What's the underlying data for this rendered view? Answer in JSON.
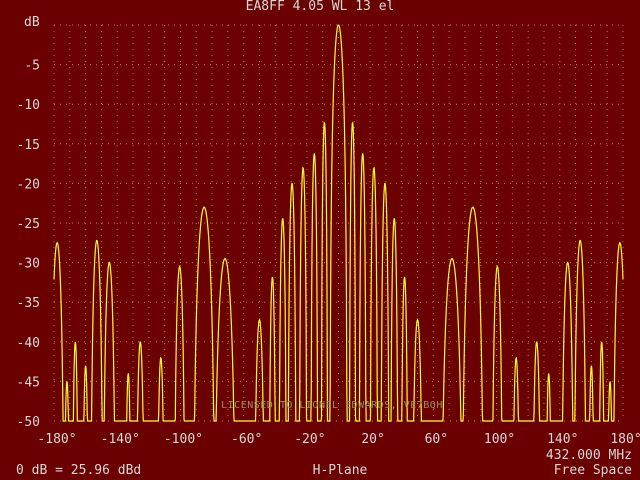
{
  "window": {
    "title": "EA8FF  4.05 WL 13 el",
    "y_unit": "dB",
    "footer_left": "0 dB = 25.96 dBd",
    "footer_center": "H-Plane",
    "frequency": "432.000 MHz",
    "footer_right": "Free Space",
    "watermark": "LICENSED TO LIONEL EDWARDS, VE7BQH"
  },
  "colors": {
    "background": "#6b0000",
    "trace": "#ffff30",
    "grid": "#c07070",
    "text": "#d8d8d8"
  },
  "chart_data": {
    "type": "line",
    "xlim": [
      -180,
      180
    ],
    "ylim": [
      -50,
      0
    ],
    "x_ticks": [
      {
        "v": -180,
        "label": "-180°"
      },
      {
        "v": -140,
        "label": "-140°"
      },
      {
        "v": -100,
        "label": "-100°"
      },
      {
        "v": -60,
        "label": "-60°"
      },
      {
        "v": -20,
        "label": "-20°"
      },
      {
        "v": 20,
        "label": "20°"
      },
      {
        "v": 60,
        "label": "60°"
      },
      {
        "v": 100,
        "label": "100°"
      },
      {
        "v": 140,
        "label": "140°"
      },
      {
        "v": 180,
        "label": "180°"
      }
    ],
    "y_ticks": [
      {
        "v": -5,
        "label": "-5"
      },
      {
        "v": -10,
        "label": "-10"
      },
      {
        "v": -15,
        "label": "-15"
      },
      {
        "v": -20,
        "label": "-20"
      },
      {
        "v": -25,
        "label": "-25"
      },
      {
        "v": -30,
        "label": "-30"
      },
      {
        "v": -35,
        "label": "-35"
      },
      {
        "v": -40,
        "label": "-40"
      },
      {
        "v": -45,
        "label": "-45"
      },
      {
        "v": -50,
        "label": "-50"
      }
    ],
    "grid": true,
    "pattern_lobes": [
      {
        "center": 0,
        "peak": 0,
        "halfwidth": 5.5
      },
      {
        "center": 8.9,
        "peak": -12.3,
        "halfwidth": 2.0
      },
      {
        "center": -8.9,
        "peak": -12.3,
        "halfwidth": 2.0
      },
      {
        "center": 15.3,
        "peak": -16.2,
        "halfwidth": 2.2
      },
      {
        "center": -15.3,
        "peak": -16.2,
        "halfwidth": 2.2
      },
      {
        "center": 22.4,
        "peak": -18.0,
        "halfwidth": 2.4
      },
      {
        "center": -22.4,
        "peak": -18.0,
        "halfwidth": 2.4
      },
      {
        "center": 29.4,
        "peak": -20.0,
        "halfwidth": 2.6
      },
      {
        "center": -29.4,
        "peak": -20.0,
        "halfwidth": 2.6
      },
      {
        "center": 35.3,
        "peak": -24.4,
        "halfwidth": 2.4
      },
      {
        "center": -35.3,
        "peak": -24.4,
        "halfwidth": 2.4
      },
      {
        "center": 41.8,
        "peak": -31.8,
        "halfwidth": 2.2
      },
      {
        "center": -41.8,
        "peak": -31.8,
        "halfwidth": 2.2
      },
      {
        "center": 50.0,
        "peak": -37.2,
        "halfwidth": 3.5
      },
      {
        "center": -50.0,
        "peak": -37.2,
        "halfwidth": 3.5
      },
      {
        "center": 71.8,
        "peak": -29.5,
        "halfwidth": 7.0
      },
      {
        "center": -71.8,
        "peak": -29.5,
        "halfwidth": 7.0
      },
      {
        "center": 85.0,
        "peak": -23.0,
        "halfwidth": 7.0
      },
      {
        "center": -85.0,
        "peak": -23.0,
        "halfwidth": 7.0
      },
      {
        "center": 100.5,
        "peak": -30.5,
        "halfwidth": 3.5
      },
      {
        "center": -100.5,
        "peak": -30.5,
        "halfwidth": 3.5
      },
      {
        "center": 112.4,
        "peak": -42.0,
        "halfwidth": 2.5
      },
      {
        "center": -112.4,
        "peak": -42.0,
        "halfwidth": 2.5
      },
      {
        "center": 125.4,
        "peak": -40.0,
        "halfwidth": 2.8
      },
      {
        "center": -125.4,
        "peak": -40.0,
        "halfwidth": 2.8
      },
      {
        "center": 133.0,
        "peak": -44.0,
        "halfwidth": 2.0
      },
      {
        "center": -133.0,
        "peak": -44.0,
        "halfwidth": 2.0
      },
      {
        "center": 145.0,
        "peak": -30.0,
        "halfwidth": 4.0
      },
      {
        "center": -145.0,
        "peak": -30.0,
        "halfwidth": 4.0
      },
      {
        "center": 152.9,
        "peak": -27.2,
        "halfwidth": 4.0
      },
      {
        "center": -152.9,
        "peak": -27.2,
        "halfwidth": 4.0
      },
      {
        "center": 160.0,
        "peak": -43.0,
        "halfwidth": 2.0
      },
      {
        "center": -160.0,
        "peak": -43.0,
        "halfwidth": 2.0
      },
      {
        "center": 166.5,
        "peak": -40.0,
        "halfwidth": 2.0
      },
      {
        "center": -166.5,
        "peak": -40.0,
        "halfwidth": 2.0
      },
      {
        "center": 171.8,
        "peak": -45.0,
        "halfwidth": 2.0
      },
      {
        "center": -171.8,
        "peak": -45.0,
        "halfwidth": 2.0
      },
      {
        "center": 178.0,
        "peak": -27.5,
        "halfwidth": 4.5
      },
      {
        "center": -178.0,
        "peak": -27.5,
        "halfwidth": 4.5
      }
    ]
  }
}
